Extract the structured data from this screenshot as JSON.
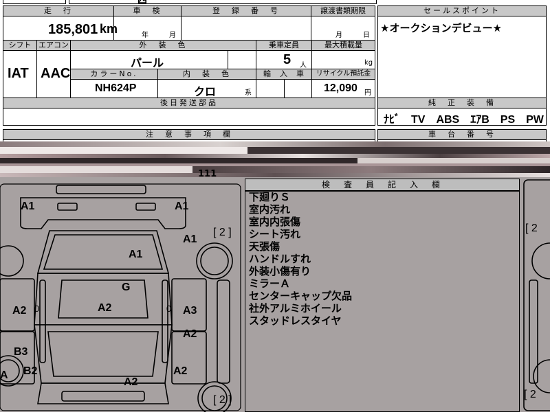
{
  "top_partial": {
    "left_glyphs": "四",
    "right_glyphs": ""
  },
  "headers": {
    "mileage": "走　行",
    "inspection": "車　検",
    "registration": "登　録　番　号",
    "transfer_deadline": "譲渡書類期限",
    "sales_point": "セールスポイント",
    "shift": "シフト",
    "aircon": "エアコン",
    "exterior_color": "外　装　色",
    "capacity": "乗車定員",
    "max_load": "最大積載量",
    "color_no": "カラーNo.",
    "interior_color": "内　装　色",
    "import": "輸　入　車",
    "recycle": "リサイクル預託金",
    "later_parts": "後日発送部品",
    "equipment": "純　正　装　備",
    "caution": "注　意　事　項　欄",
    "chassis_no": "車　台　番　号",
    "inspector_notes": "検　査　員　記　入　欄"
  },
  "values": {
    "mileage": "185,801",
    "mileage_unit": "km",
    "year_unit": "年",
    "month_unit": "月",
    "deadline_month": "月",
    "deadline_day": "日",
    "sales_point_text": "★オークションデビュー★",
    "shift": "IAT",
    "aircon": "AAC",
    "exterior_color": "パール",
    "capacity": "5",
    "capacity_unit": "人",
    "load_unit": "kg",
    "color_no": "NH624P",
    "interior_color": "クロ",
    "interior_suffix": "系",
    "recycle_amount": "12,090",
    "recycle_unit": "円",
    "equipment": "ﾅﾋﾞ　TV　ABS　ｴｱB　PS　PW"
  },
  "diagram_marks": {
    "rear_left": "A1",
    "rear_right": "A1",
    "right_rear_side": "A1",
    "roof": "A1",
    "glass": "G",
    "left_rear_door": "A2",
    "left_rear_door_extra": "0",
    "center_body": "A2",
    "right_rear_door": "A3",
    "right_rear_door_extra": "0",
    "right_front_door": "A2",
    "left_front_door_b": "B3",
    "left_front_door_a": "B2",
    "left_front_fender": "A",
    "hood": "A2",
    "right_front_fender": "A2",
    "right_count_top": "[ 2 ]",
    "right_count_bottom": "[ 2 ]",
    "far_right_top": "[ 2",
    "far_right_bottom": "[ 2",
    "partial_label": "111"
  },
  "inspector_notes": [
    "下廻りＳ",
    "室内汚れ",
    "室内内張傷",
    "シート汚れ",
    "天張傷",
    "ハンドルすれ",
    "外装小傷有り",
    "ミラーＡ",
    "センターキャップ欠品",
    "社外アルミホイール",
    "スタッドレスタイヤ"
  ],
  "colors": {
    "sheet_bg": "#a7a1a1",
    "header_gray": "#c8c8c8"
  }
}
